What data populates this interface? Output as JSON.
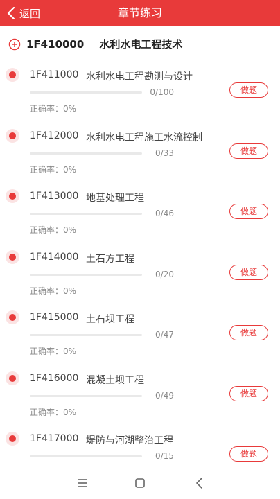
{
  "header": {
    "back_label": "返回",
    "title": "章节练习"
  },
  "chapter": {
    "code": "1F410000",
    "name": "水利水电工程技术"
  },
  "items": [
    {
      "code": "1F411000",
      "name": "水利水电工程勘测与设计",
      "progress": "0/100",
      "accuracy_label": "正确率：0%",
      "button": "做题"
    },
    {
      "code": "1F412000",
      "name": "水利水电工程施工水流控制",
      "progress": "0/33",
      "accuracy_label": "正确率：0%",
      "button": "做题"
    },
    {
      "code": "1F413000",
      "name": "地基处理工程",
      "progress": "0/46",
      "accuracy_label": "正确率：0%",
      "button": "做题"
    },
    {
      "code": "1F414000",
      "name": "土石方工程",
      "progress": "0/20",
      "accuracy_label": "正确率：0%",
      "button": "做题"
    },
    {
      "code": "1F415000",
      "name": "土石坝工程",
      "progress": "0/47",
      "accuracy_label": "正确率：0%",
      "button": "做题"
    },
    {
      "code": "1F416000",
      "name": "混凝土坝工程",
      "progress": "0/49",
      "accuracy_label": "正确率：0%",
      "button": "做题"
    },
    {
      "code": "1F417000",
      "name": "堤防与河湖整治工程",
      "progress": "0/15",
      "accuracy_label": "",
      "button": "做题"
    }
  ],
  "colors": {
    "accent": "#e83a3a",
    "dot_halo": "#fbe3e3",
    "track": "#e9e9e9"
  },
  "icons": {
    "back": "chevron-left-icon",
    "expand": "plus-circle-icon",
    "item_marker": "dot-icon",
    "nav_menu": "menu-icon",
    "nav_home": "square-icon",
    "nav_back": "chevron-left-icon"
  }
}
